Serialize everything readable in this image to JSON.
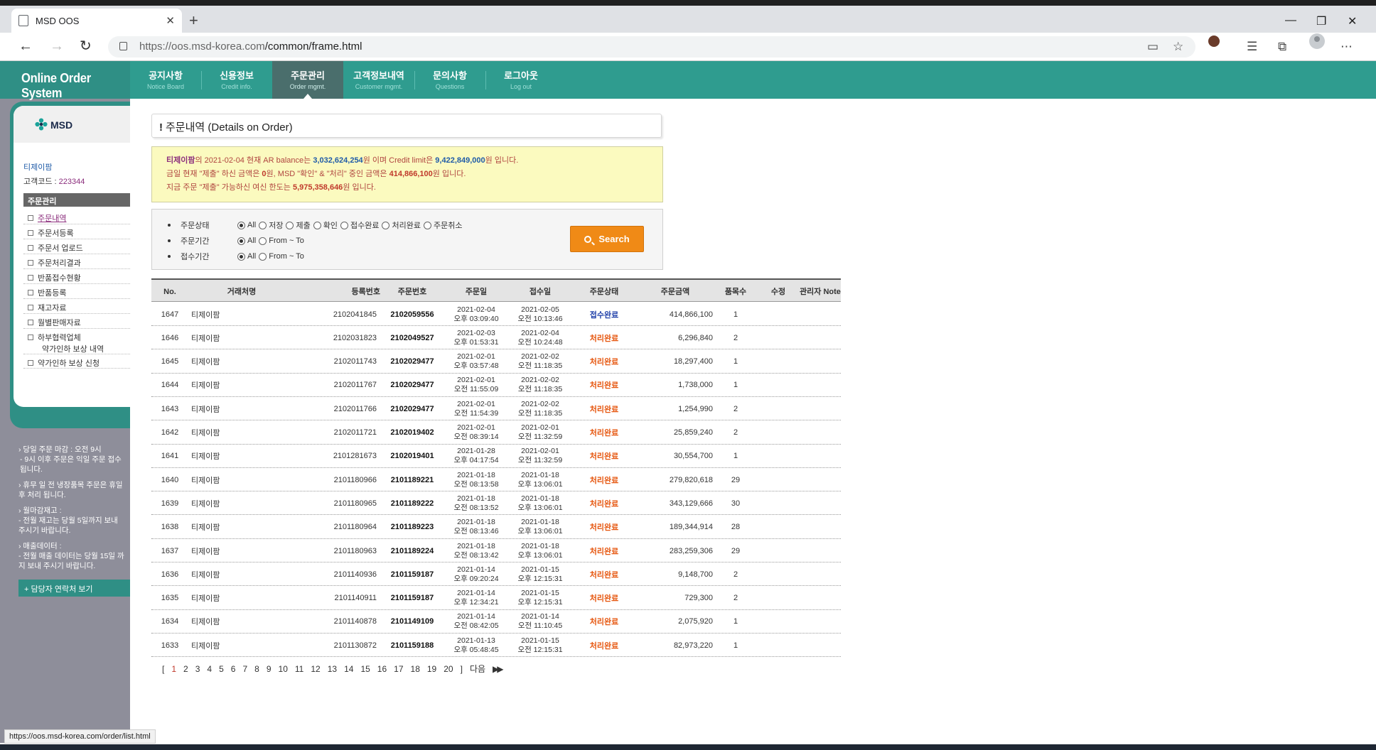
{
  "browser": {
    "tab_title": "MSD OOS",
    "url_host": "https://oos.msd-korea.com",
    "url_path": "/common/frame.html",
    "status_url": "https://oos.msd-korea.com/order/list.html"
  },
  "brand": {
    "system_name": "Online Order System",
    "company": "MSD"
  },
  "customer": {
    "name": "티제이팜",
    "code_label": "고객코드 : ",
    "code": "223344"
  },
  "sidebar": {
    "menu_title": "주문관리",
    "items": [
      {
        "label": "주문내역"
      },
      {
        "label": "주문서등록"
      },
      {
        "label": "주문서 업로드"
      },
      {
        "label": "주문처리결과"
      },
      {
        "label": "반품접수현황"
      },
      {
        "label": "반품등록"
      },
      {
        "label": "재고자료"
      },
      {
        "label": "월별판매자료"
      },
      {
        "label": "하부협력업체"
      },
      {
        "label": "약가인하 보상 신청"
      }
    ],
    "sub_item": "약가인하 보상 내역",
    "notices": [
      "› 당일 주문 마감 : 오전 9시",
      "- 9시 이후 주문은 익일 주문 접수 됩니다.",
      "› 휴무 일 전 냉장품목 주문은 휴일 후 처리 됩니다.",
      "› 월마감재고 :",
      "- 전월 재고는 당월 5일까지 보내 주시기 바랍니다.",
      "› 매출데이터 :",
      "- 전월 매출 데이터는 당월 15일 까지 보내 주시기 바랍니다."
    ],
    "contact_button": "+ 담당자 연락처 보기"
  },
  "topnav": [
    {
      "ko": "공지사항",
      "en": "Notice Board"
    },
    {
      "ko": "신용정보",
      "en": "Credit info."
    },
    {
      "ko": "주문관리",
      "en": "Order mgmt."
    },
    {
      "ko": "고객정보내역",
      "en": "Customer mgmt."
    },
    {
      "ko": "문의사항",
      "en": "Questions"
    },
    {
      "ko": "로그아웃",
      "en": "Log out"
    }
  ],
  "page_title": "주문내역 (Details on Order)",
  "info": {
    "l1_a": "티제이팜",
    "l1_b": "의 2021-02-04 현재 AR balance는 ",
    "l1_c": "3,032,624,254",
    "l1_d": "원 이며 Credit limit은 ",
    "l1_e": "9,422,849,000",
    "l1_f": "원 입니다.",
    "l2_a": "금일 현재 \"제출\" 하신 금액은 ",
    "l2_b": "0",
    "l2_c": "원, MSD \"확인\" & \"처리\" 중인 금액은 ",
    "l2_d": "414,866,100",
    "l2_e": "원 입니다.",
    "l3_a": "지금 주문 \"제출\" 가능하신 여신 한도는 ",
    "l3_b": "5,975,358,646",
    "l3_c": "원 입니다."
  },
  "filters": {
    "status_label": "주문상태",
    "status_options": [
      "All",
      "저장",
      "제출",
      "확인",
      "접수완료",
      "처리완료",
      "주문취소"
    ],
    "period_label": "주문기간",
    "receipt_label": "접수기간",
    "all": "All",
    "from_to": "From ~ To",
    "search_button": "Search"
  },
  "table": {
    "headers": [
      "No.",
      "거래처명",
      "등록번호",
      "주문번호",
      "주문일",
      "접수일",
      "주문상태",
      "주문금액",
      "품목수",
      "수정",
      "관리자 Note"
    ],
    "rows": [
      {
        "no": "1647",
        "client": "티제이팜",
        "reg": "2102041845",
        "order": "2102059556",
        "od": "2021-02-04",
        "ot": "오후 03:09:40",
        "rd": "2021-02-05",
        "rt": "오전 10:13:46",
        "status": "접수완료",
        "amount": "414,866,100",
        "items": "1"
      },
      {
        "no": "1646",
        "client": "티제이팜",
        "reg": "2102031823",
        "order": "2102049527",
        "od": "2021-02-03",
        "ot": "오후 01:53:31",
        "rd": "2021-02-04",
        "rt": "오전 10:24:48",
        "status": "처리완료",
        "amount": "6,296,840",
        "items": "2"
      },
      {
        "no": "1645",
        "client": "티제이팜",
        "reg": "2102011743",
        "order": "2102029477",
        "od": "2021-02-01",
        "ot": "오후 03:57:48",
        "rd": "2021-02-02",
        "rt": "오전 11:18:35",
        "status": "처리완료",
        "amount": "18,297,400",
        "items": "1"
      },
      {
        "no": "1644",
        "client": "티제이팜",
        "reg": "2102011767",
        "order": "2102029477",
        "od": "2021-02-01",
        "ot": "오전 11:55:09",
        "rd": "2021-02-02",
        "rt": "오전 11:18:35",
        "status": "처리완료",
        "amount": "1,738,000",
        "items": "1"
      },
      {
        "no": "1643",
        "client": "티제이팜",
        "reg": "2102011766",
        "order": "2102029477",
        "od": "2021-02-01",
        "ot": "오전 11:54:39",
        "rd": "2021-02-02",
        "rt": "오전 11:18:35",
        "status": "처리완료",
        "amount": "1,254,990",
        "items": "2"
      },
      {
        "no": "1642",
        "client": "티제이팜",
        "reg": "2102011721",
        "order": "2102019402",
        "od": "2021-02-01",
        "ot": "오전 08:39:14",
        "rd": "2021-02-01",
        "rt": "오전 11:32:59",
        "status": "처리완료",
        "amount": "25,859,240",
        "items": "2"
      },
      {
        "no": "1641",
        "client": "티제이팜",
        "reg": "2101281673",
        "order": "2102019401",
        "od": "2021-01-28",
        "ot": "오후 04:17:54",
        "rd": "2021-02-01",
        "rt": "오전 11:32:59",
        "status": "처리완료",
        "amount": "30,554,700",
        "items": "1"
      },
      {
        "no": "1640",
        "client": "티제이팜",
        "reg": "2101180966",
        "order": "2101189221",
        "od": "2021-01-18",
        "ot": "오전 08:13:58",
        "rd": "2021-01-18",
        "rt": "오후 13:06:01",
        "status": "처리완료",
        "amount": "279,820,618",
        "items": "29"
      },
      {
        "no": "1639",
        "client": "티제이팜",
        "reg": "2101180965",
        "order": "2101189222",
        "od": "2021-01-18",
        "ot": "오전 08:13:52",
        "rd": "2021-01-18",
        "rt": "오후 13:06:01",
        "status": "처리완료",
        "amount": "343,129,666",
        "items": "30"
      },
      {
        "no": "1638",
        "client": "티제이팜",
        "reg": "2101180964",
        "order": "2101189223",
        "od": "2021-01-18",
        "ot": "오전 08:13:46",
        "rd": "2021-01-18",
        "rt": "오후 13:06:01",
        "status": "처리완료",
        "amount": "189,344,914",
        "items": "28"
      },
      {
        "no": "1637",
        "client": "티제이팜",
        "reg": "2101180963",
        "order": "2101189224",
        "od": "2021-01-18",
        "ot": "오전 08:13:42",
        "rd": "2021-01-18",
        "rt": "오후 13:06:01",
        "status": "처리완료",
        "amount": "283,259,306",
        "items": "29"
      },
      {
        "no": "1636",
        "client": "티제이팜",
        "reg": "2101140936",
        "order": "2101159187",
        "od": "2021-01-14",
        "ot": "오후 09:20:24",
        "rd": "2021-01-15",
        "rt": "오후 12:15:31",
        "status": "처리완료",
        "amount": "9,148,700",
        "items": "2"
      },
      {
        "no": "1635",
        "client": "티제이팜",
        "reg": "2101140911",
        "order": "2101159187",
        "od": "2021-01-14",
        "ot": "오후 12:34:21",
        "rd": "2021-01-15",
        "rt": "오후 12:15:31",
        "status": "처리완료",
        "amount": "729,300",
        "items": "2"
      },
      {
        "no": "1634",
        "client": "티제이팜",
        "reg": "2101140878",
        "order": "2101149109",
        "od": "2021-01-14",
        "ot": "오전 08:42:05",
        "rd": "2021-01-14",
        "rt": "오전 11:10:45",
        "status": "처리완료",
        "amount": "2,075,920",
        "items": "1"
      },
      {
        "no": "1633",
        "client": "티제이팜",
        "reg": "2101130872",
        "order": "2101159188",
        "od": "2021-01-13",
        "ot": "오후 05:48:45",
        "rd": "2021-01-15",
        "rt": "오전 12:15:31",
        "status": "처리완료",
        "amount": "82,973,220",
        "items": "1"
      }
    ]
  },
  "pager": {
    "open": "[",
    "pages": [
      "1",
      "2",
      "3",
      "4",
      "5",
      "6",
      "7",
      "8",
      "9",
      "10",
      "11",
      "12",
      "13",
      "14",
      "15",
      "16",
      "17",
      "18",
      "19",
      "20"
    ],
    "close": "]",
    "next": "다음",
    "last": "▶▶"
  },
  "colors": {
    "teal": "#2f9c8f",
    "status_received": "#1f3fa8",
    "status_processed": "#e6550d",
    "search_orange": "#f08a16"
  }
}
